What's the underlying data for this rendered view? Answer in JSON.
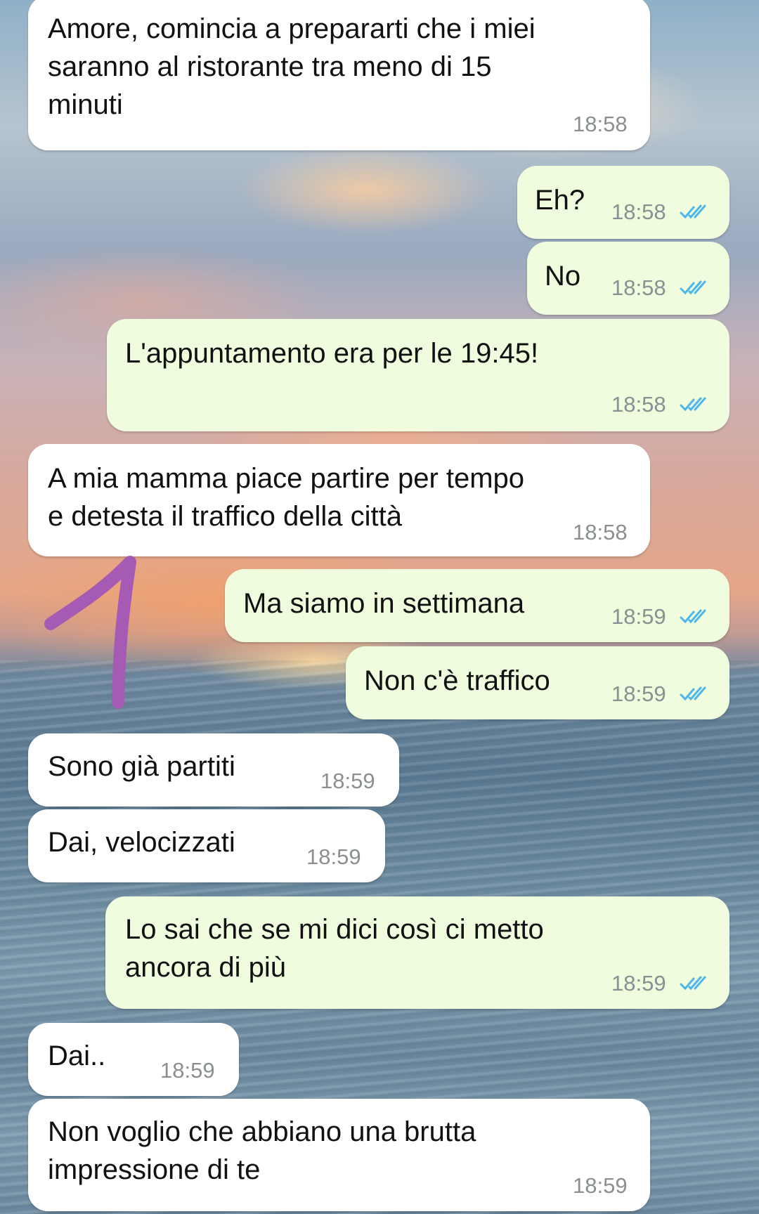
{
  "messages": [
    {
      "dir": "in",
      "text": "Amore, comincia a prepararti che i miei\nsaranno al ristorante tra meno di 15\nminuti",
      "time": "18:58"
    },
    {
      "dir": "out",
      "text": "Eh?",
      "time": "18:58",
      "read": true
    },
    {
      "dir": "out",
      "text": "No",
      "time": "18:58",
      "read": true
    },
    {
      "dir": "out",
      "text": "L'appuntamento era per le 19:45!",
      "time": "18:58",
      "read": true
    },
    {
      "dir": "in",
      "text": "A mia mamma piace partire per tempo\ne detesta il traffico della città",
      "time": "18:58"
    },
    {
      "dir": "out",
      "text": "Ma siamo in settimana",
      "time": "18:59",
      "read": true
    },
    {
      "dir": "out",
      "text": "Non c'è traffico",
      "time": "18:59",
      "read": true
    },
    {
      "dir": "in",
      "text": "Sono già partiti",
      "time": "18:59"
    },
    {
      "dir": "in",
      "text": "Dai, velocizzati",
      "time": "18:59"
    },
    {
      "dir": "out",
      "text": "Lo sai che se mi dici così ci metto\nancora di più",
      "time": "18:59",
      "read": true
    },
    {
      "dir": "in",
      "text": "Dai..",
      "time": "18:59"
    },
    {
      "dir": "in",
      "text": "Non voglio che abbiano una brutta\nimpressione di te",
      "time": "18:59"
    }
  ],
  "colors": {
    "incoming_bubble": "#ffffff",
    "outgoing_bubble": "#effdde",
    "read_ticks": "#4fb6ec",
    "timestamp": "#8a8f92",
    "annotation_arrow": "#a55bb4"
  },
  "icons": {
    "read_receipt": "double-check-icon",
    "annotation": "hand-drawn-arrow-icon"
  }
}
